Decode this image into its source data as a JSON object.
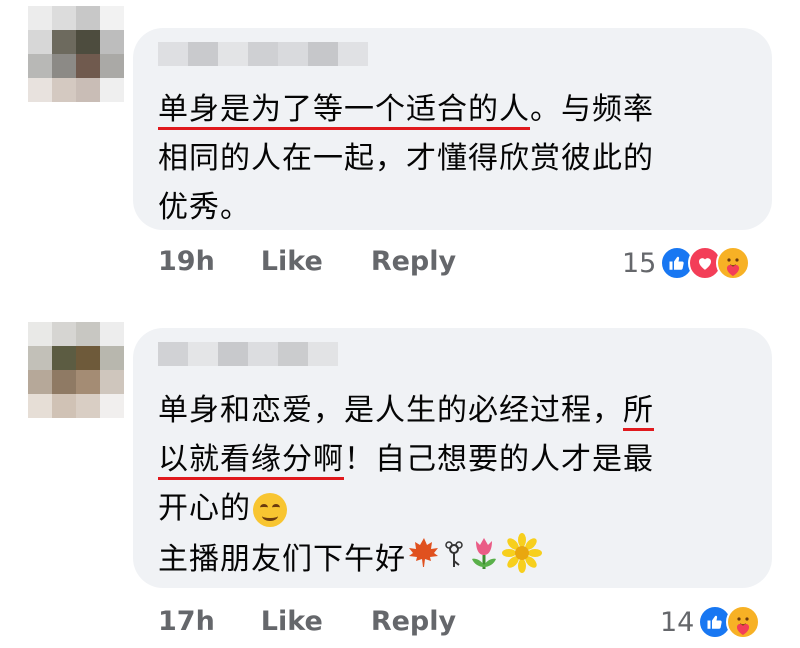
{
  "comments": [
    {
      "text_lines": [
        {
          "segments": [
            {
              "text": "单身是为了等一个适合的人",
              "underline": true
            },
            {
              "text": "。与频率",
              "underline": false
            }
          ]
        },
        {
          "segments": [
            {
              "text": "相同的人在一起，才懂得欣赏彼此的",
              "underline": false
            }
          ]
        },
        {
          "segments": [
            {
              "text": "优秀。",
              "underline": false
            }
          ]
        }
      ],
      "time": "19h",
      "like_label": "Like",
      "reply_label": "Reply",
      "reaction_count": "15",
      "reactions": [
        "like-icon",
        "love-icon",
        "care-icon"
      ]
    },
    {
      "text_lines": [
        {
          "segments": [
            {
              "text": "单身和恋爱，是人生的必经过程，",
              "underline": false
            },
            {
              "text": "所",
              "underline": true
            }
          ]
        },
        {
          "segments": [
            {
              "text": "以就看缘分啊",
              "underline": true
            },
            {
              "text": "！自己想要的人才是最",
              "underline": false
            }
          ]
        },
        {
          "segments": [
            {
              "text": "开心的",
              "underline": false
            }
          ]
        },
        {
          "segments": [
            {
              "text": "主播朋友们下午好",
              "underline": false
            }
          ]
        }
      ],
      "emojis_line3": [
        "smiling-face-emoji"
      ],
      "emojis_line4": [
        "maple-leaf-emoji",
        "rosette-emoji",
        "tulip-emoji",
        "blossom-emoji"
      ],
      "time": "17h",
      "like_label": "Like",
      "reply_label": "Reply",
      "reaction_count": "14",
      "reactions": [
        "like-icon",
        "care-icon"
      ]
    }
  ],
  "colors": {
    "bubble": "#f0f2f5",
    "meta_text": "#65676b",
    "underline": "#e0191d",
    "like": "#1877f2",
    "love": "#f33e58",
    "care": "#f7b125"
  }
}
